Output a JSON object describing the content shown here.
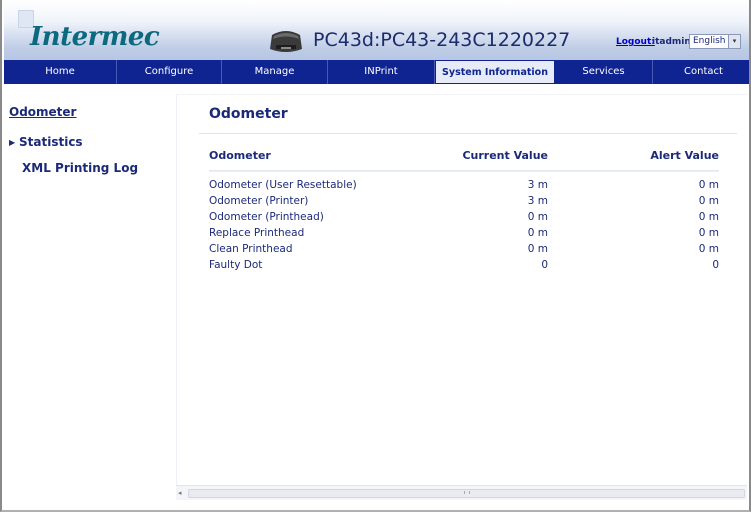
{
  "header": {
    "logo_text": "Intermec",
    "printer_title": "PC43d:PC43-243C1220227",
    "logout_label": "Logout:",
    "user": "itadmin",
    "language": "English"
  },
  "nav": {
    "tabs": [
      {
        "label": "Home"
      },
      {
        "label": "Configure"
      },
      {
        "label": "Manage"
      },
      {
        "label": "INPrint"
      },
      {
        "label": "System Information",
        "active": true
      },
      {
        "label": "Services"
      },
      {
        "label": "Contact"
      }
    ]
  },
  "sidebar": {
    "items": [
      {
        "label": "Odometer",
        "active": true
      },
      {
        "label": "Statistics"
      },
      {
        "label": "XML Printing Log"
      }
    ]
  },
  "main": {
    "title": "Odometer",
    "columns": [
      "Odometer",
      "Current Value",
      "Alert Value"
    ],
    "rows": [
      {
        "name": "Odometer (User Resettable)",
        "current": "3 m",
        "alert": "0 m"
      },
      {
        "name": "Odometer (Printer)",
        "current": "3 m",
        "alert": "0 m"
      },
      {
        "name": "Odometer (Printhead)",
        "current": "0 m",
        "alert": "0 m"
      },
      {
        "name": "Replace Printhead",
        "current": "0 m",
        "alert": "0 m"
      },
      {
        "name": "Clean Printhead",
        "current": "0 m",
        "alert": "0 m"
      },
      {
        "name": "Faulty Dot",
        "current": "0",
        "alert": "0"
      }
    ]
  },
  "colors": {
    "nav_bg": "#0f2490",
    "text": "#1b2a78",
    "logo": "#0c6a7f"
  }
}
